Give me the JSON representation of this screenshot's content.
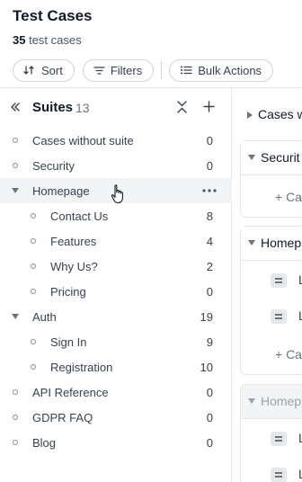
{
  "header": {
    "title": "Test Cases",
    "count_value": "35",
    "count_suffix": "test cases"
  },
  "toolbar": {
    "sort_label": "Sort",
    "filters_label": "Filters",
    "bulk_actions_label": "Bulk Actions"
  },
  "sidebar": {
    "title": "Suites",
    "count": "13",
    "items": [
      {
        "label": "Cases without suite",
        "count": "0",
        "level": 0,
        "marker": "dot"
      },
      {
        "label": "Security",
        "count": "0",
        "level": 0,
        "marker": "dot"
      },
      {
        "label": "Homepage",
        "count": "",
        "level": 0,
        "marker": "caret",
        "hovered": true
      },
      {
        "label": "Contact Us",
        "count": "8",
        "level": 1,
        "marker": "dot"
      },
      {
        "label": "Features",
        "count": "4",
        "level": 1,
        "marker": "dot"
      },
      {
        "label": "Why Us?",
        "count": "2",
        "level": 1,
        "marker": "dot"
      },
      {
        "label": "Pricing",
        "count": "0",
        "level": 1,
        "marker": "dot"
      },
      {
        "label": "Auth",
        "count": "19",
        "level": 0,
        "marker": "caret"
      },
      {
        "label": "Sign In",
        "count": "9",
        "level": 1,
        "marker": "dot"
      },
      {
        "label": "Registration",
        "count": "10",
        "level": 1,
        "marker": "dot"
      },
      {
        "label": "API Reference",
        "count": "0",
        "level": 0,
        "marker": "dot"
      },
      {
        "label": "GDPR FAQ",
        "count": "0",
        "level": 0,
        "marker": "dot"
      },
      {
        "label": "Blog",
        "count": "0",
        "level": 0,
        "marker": "dot"
      }
    ]
  },
  "main": {
    "card1_title": "Cases w",
    "card2_title": "Securit",
    "card2_add": "+ Ca",
    "card3_title": "Homep",
    "card3_line": "L",
    "card3_add": "+ Ca",
    "card4_title": "Homep",
    "card4_line": "L"
  },
  "icons": {
    "sort": "sort-icon",
    "filters": "filter-icon",
    "bulk_actions": "list-icon",
    "collapse_sidebar": "double-chevron-left-icon",
    "collapse_all": "collapse-all-icon",
    "add": "plus-icon",
    "more": "more-horizontal-icon",
    "cursor": "hand-pointer-icon"
  }
}
